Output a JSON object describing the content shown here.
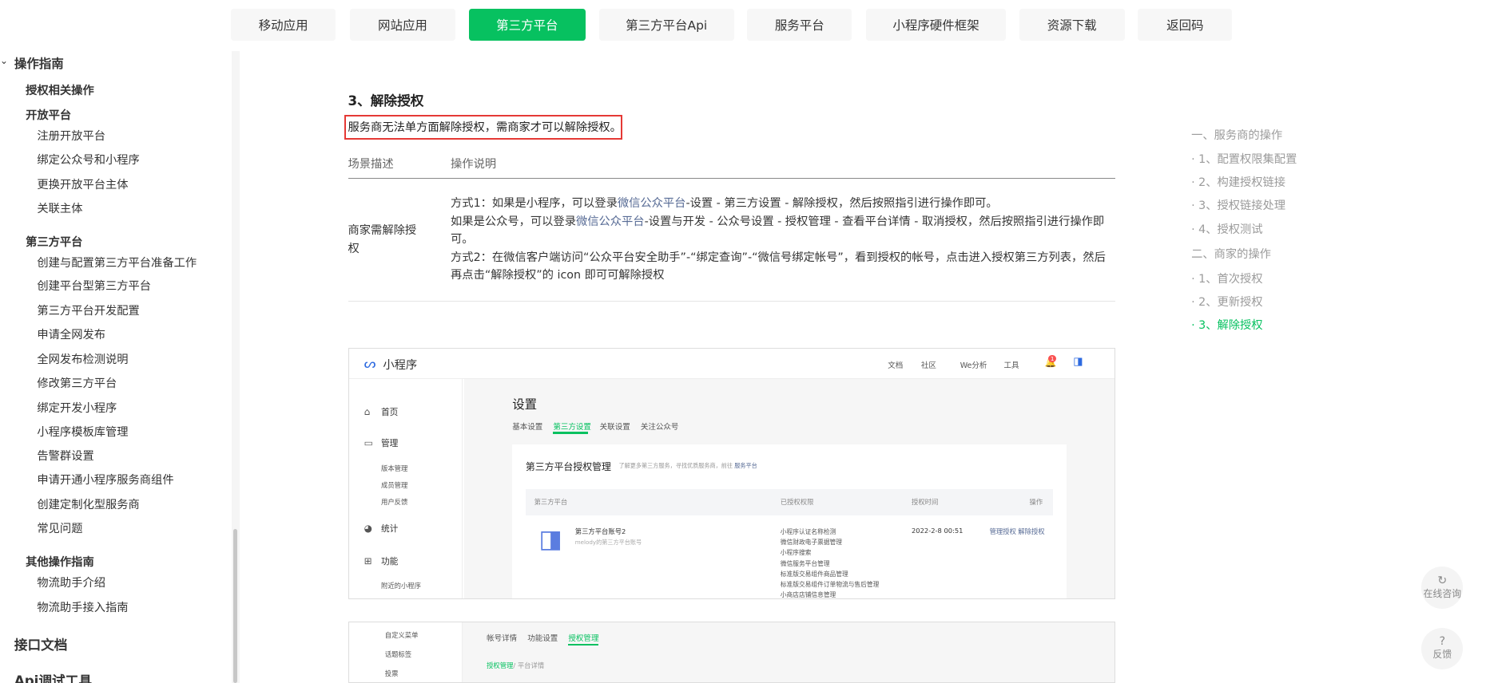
{
  "nav": {
    "tabs": [
      "移动应用",
      "网站应用",
      "第三方平台",
      "第三方平台Api",
      "服务平台",
      "小程序硬件框架",
      "资源下载",
      "返回码"
    ]
  },
  "sidebar": {
    "top_partial": "操作指南",
    "groups": [
      {
        "title": "授权相关操作",
        "items": []
      },
      {
        "title": "开放平台",
        "items": [
          "注册开放平台",
          "绑定公众号和小程序",
          "更换开放平台主体",
          "关联主体"
        ]
      },
      {
        "title": "第三方平台",
        "items": [
          "创建与配置第三方平台准备工作",
          "创建平台型第三方平台",
          "第三方平台开发配置",
          "申请全网发布",
          "全网发布检测说明",
          "修改第三方平台",
          "绑定开发小程序",
          "小程序模板库管理",
          "告警群设置",
          "申请开通小程序服务商组件",
          "创建定制化型服务商",
          "常见问题"
        ]
      },
      {
        "title": "其他操作指南",
        "items": [
          "物流助手介绍",
          "物流助手接入指南"
        ]
      }
    ],
    "bottom": [
      "接口文档",
      "Api调试工具"
    ]
  },
  "content": {
    "section_title": "3、解除授权",
    "note": "服务商无法单方面解除授权，需商家才可以解除授权。",
    "table": {
      "headers": [
        "场景描述",
        "操作说明"
      ],
      "scene": "商家需解除授权",
      "m1_pre": "方式1：如果是小程序，可以登录",
      "m1_link": "微信公众平台",
      "m1_post": "-设置 - 第三方设置 - 解除授权，然后按照指引进行操作即可。",
      "m1b_pre": "如果是公众号，可以登录",
      "m1b_link": "微信公众平台",
      "m1b_post": "-设置与开发 - 公众号设置 - 授权管理 - 查看平台详情 - 取消授权，然后按照指引进行操作即可。",
      "m2": "方式2：在微信客户端访问“公众平台安全助手”-“绑定查询”-“微信号绑定帐号”，看到授权的帐号，点击进入授权第三方列表，然后再点击“解除授权”的 icon 即可可解除授权"
    }
  },
  "shot1": {
    "brand": "小程序",
    "header_links": [
      "文档",
      "社区",
      "We分析",
      "工具"
    ],
    "menu": [
      "首页",
      "管理",
      "统计",
      "功能"
    ],
    "manage_sub": [
      "版本管理",
      "成员管理",
      "用户反馈"
    ],
    "func_sub": [
      "附近的小程序"
    ],
    "page_title": "设置",
    "tabs": [
      "基本设置",
      "第三方设置",
      "关联设置",
      "关注公众号"
    ],
    "card_title": "第三方平台授权管理",
    "card_desc_pre": "了解更多第三方服务，寻找优质服务商，前往",
    "card_desc_link": "服务平台",
    "cols": [
      "第三方平台",
      "已授权权限",
      "授权时间",
      "操作"
    ],
    "row": {
      "name": "第三方平台账号2",
      "sub": "melody的第三方平台账号",
      "perms": [
        "小程序认证名称检测",
        "微信财政电子票据管理",
        "小程序搜索",
        "微信服务平台管理",
        "标准版交易组件商品管理",
        "标准版交易组件订单物流与售后管理",
        "小商店店铺信息管理"
      ],
      "time": "2022-2-8 00:51",
      "action1": "管理授权",
      "action2": "解除授权"
    },
    "badge": "1"
  },
  "shot2": {
    "menu": [
      "自定义菜单",
      "话题标签",
      "投票"
    ],
    "tabs": [
      "帐号详情",
      "功能设置",
      "授权管理"
    ],
    "crumb_link": "授权管理",
    "crumb_rest": "/ 平台详情"
  },
  "toc": [
    {
      "label": "一、服务商的操作",
      "active": false
    },
    {
      "label": "· 1、配置权限集配置",
      "active": false
    },
    {
      "label": "· 2、构建授权链接",
      "active": false
    },
    {
      "label": "· 3、授权链接处理",
      "active": false
    },
    {
      "label": "· 4、授权测试",
      "active": false
    },
    {
      "label": "二、商家的操作",
      "active": false
    },
    {
      "label": "· 1、首次授权",
      "active": false
    },
    {
      "label": "· 2、更新授权",
      "active": false
    },
    {
      "label": "· 3、解除授权",
      "active": true
    }
  ],
  "float": {
    "consult": "在线咨询",
    "feedback": "反馈"
  },
  "colors": {
    "accent": "#07c160",
    "link": "#576b95",
    "highlight_border": "#e53935"
  }
}
